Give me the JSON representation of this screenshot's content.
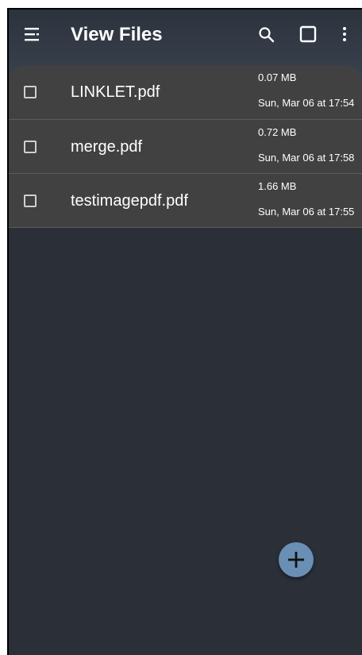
{
  "app_bar": {
    "title": "View Files",
    "icons": [
      "menu-icon",
      "search-icon",
      "select-all-icon",
      "more-vert-icon"
    ]
  },
  "files": [
    {
      "name": "LINKLET.pdf",
      "size": "0.07 MB",
      "date": "Sun, Mar 06 at 17:54"
    },
    {
      "name": "merge.pdf",
      "size": "0.72 MB",
      "date": "Sun, Mar 06 at 17:58"
    },
    {
      "name": "testimagepdf.pdf",
      "size": "1.66 MB",
      "date": "Sun, Mar 06 at 17:55"
    }
  ],
  "fab": {
    "icon": "plus-icon"
  },
  "colors": {
    "background": "#2b2f38",
    "list_background": "#414141",
    "fab": "#6a8fb5",
    "text": "#ffffff"
  }
}
